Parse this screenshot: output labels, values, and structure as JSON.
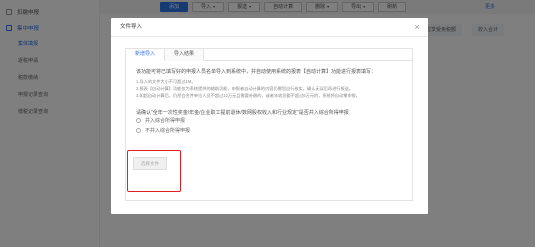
{
  "sidebar": {
    "items": [
      {
        "label": "扣缴申报",
        "type": "group"
      },
      {
        "label": "集中申报",
        "type": "group",
        "active": true
      },
      {
        "label": "集体填报",
        "type": "item",
        "active": true
      },
      {
        "label": "逐税申请",
        "type": "item"
      },
      {
        "label": "税款缴纳",
        "type": "item"
      },
      {
        "label": "申报记录查询",
        "type": "item"
      },
      {
        "label": "缴税记录查询",
        "type": "item"
      }
    ]
  },
  "toolbar": {
    "buttons": [
      {
        "label": "添加",
        "primary": true
      },
      {
        "label": "导入",
        "caret": true
      },
      {
        "label": "报送",
        "caret": true
      },
      {
        "label": "自动计算"
      },
      {
        "label": "删除",
        "caret": true
      },
      {
        "label": "导出",
        "caret": true
      },
      {
        "label": "刷新"
      }
    ],
    "more_label": "更多"
  },
  "table": {
    "right_headers": [
      "应享受免税额",
      "收入合计"
    ]
  },
  "modal": {
    "title": "文件导入",
    "tabs": [
      "新增导入",
      "导入结果"
    ],
    "intro": "该功能可将已填写好的申报人员名单导入到系统中，并自动使用系统的报表【自动计算】功能进行报表填写：",
    "tips": [
      "1.导入的文件大小不可超过1M。",
      "2.报表【自动计算】功能仅为系统提供的辅助功能，申报者自动计算的内容仍需您自行核实，确认无误后再进行报送。",
      "3.如超自动计算后，仍然会合并单位人员不超过12万元且需要补缴的，或者年收总额不超过6万元的，系统将自动零申报。"
    ],
    "question": "请确认\"全年一次性奖金/年金/企业职工提前退休/数网股权收入和行业规定\"是否并入综合所得申报",
    "radio_options": [
      "并入综合所得申报",
      "不并入综合所得申报"
    ],
    "upload_button": "选择文件"
  },
  "colors": {
    "primary": "#2d74e7",
    "highlight": "#e02020",
    "overlay": "rgba(0,0,0,0.5)"
  }
}
